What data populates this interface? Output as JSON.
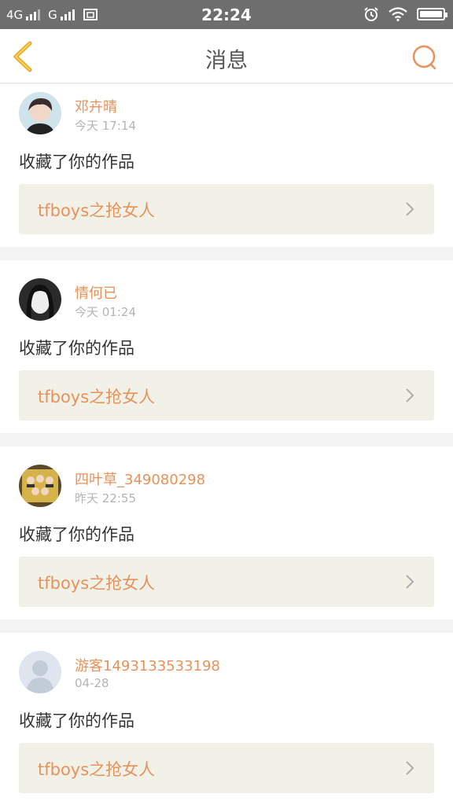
{
  "status_bar": {
    "network1": "4G",
    "network2": "G",
    "time": "22:24",
    "icons": [
      "signal-icon",
      "sim-icon",
      "alarm-icon",
      "wifi-icon",
      "battery-icon"
    ]
  },
  "nav": {
    "title": "消息",
    "back_icon": "chevron-left-icon",
    "search_icon": "search-icon"
  },
  "colors": {
    "accent": "#e8915a",
    "back": "#e8a81f",
    "card_bg": "#ffffff",
    "work_bg": "#f2f1e8"
  },
  "messages": [
    {
      "user": "邓卉晴",
      "time": "今天 17:14",
      "action": "收藏了你的作品",
      "work": "tfboys之抢女人"
    },
    {
      "user": "情何已",
      "time": "今天 01:24",
      "action": "收藏了你的作品",
      "work": "tfboys之抢女人"
    },
    {
      "user": "四叶草_349080298",
      "time": "昨天 22:55",
      "action": "收藏了你的作品",
      "work": "tfboys之抢女人"
    },
    {
      "user": "游客1493133533198",
      "time": "04-28",
      "action": "收藏了你的作品",
      "work": "tfboys之抢女人"
    }
  ]
}
